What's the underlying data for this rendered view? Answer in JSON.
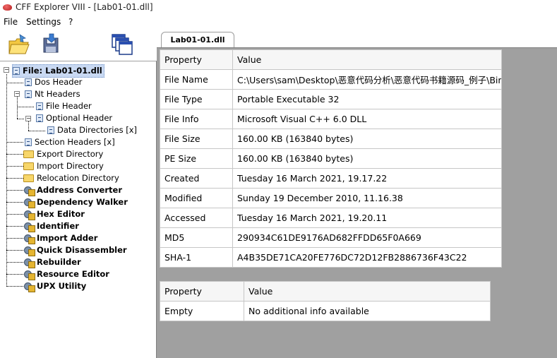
{
  "window": {
    "title": "CFF Explorer VIII - [Lab01-01.dll]"
  },
  "menu": [
    {
      "label": "File"
    },
    {
      "label": "Settings"
    },
    {
      "label": "?"
    }
  ],
  "toolbar": [
    {
      "icon": "open-folder-icon"
    },
    {
      "icon": "save-disk-icon"
    },
    {
      "icon": "windows-cascade-icon"
    }
  ],
  "tree": {
    "root": "File: Lab01-01.dll",
    "items": [
      {
        "label": "Dos Header",
        "icon": "document-icon",
        "bold": false
      },
      {
        "label": "Nt Headers",
        "icon": "document-icon",
        "bold": false
      },
      {
        "label": "File Header",
        "icon": "document-icon",
        "bold": false
      },
      {
        "label": "Optional Header",
        "icon": "document-icon",
        "bold": false
      },
      {
        "label": "Data Directories [x]",
        "icon": "document-icon",
        "bold": false
      },
      {
        "label": "Section Headers [x]",
        "icon": "document-icon",
        "bold": false
      },
      {
        "label": "Export Directory",
        "icon": "folder-icon",
        "bold": false
      },
      {
        "label": "Import Directory",
        "icon": "folder-icon",
        "bold": false
      },
      {
        "label": "Relocation Directory",
        "icon": "folder-icon",
        "bold": false
      },
      {
        "label": "Address Converter",
        "icon": "tool-icon",
        "bold": true
      },
      {
        "label": "Dependency Walker",
        "icon": "tool-icon",
        "bold": true
      },
      {
        "label": "Hex Editor",
        "icon": "tool-icon",
        "bold": true
      },
      {
        "label": "Identifier",
        "icon": "tool-icon",
        "bold": true
      },
      {
        "label": "Import Adder",
        "icon": "tool-icon",
        "bold": true
      },
      {
        "label": "Quick Disassembler",
        "icon": "tool-icon",
        "bold": true
      },
      {
        "label": "Rebuilder",
        "icon": "tool-icon",
        "bold": true
      },
      {
        "label": "Resource Editor",
        "icon": "tool-icon",
        "bold": true
      },
      {
        "label": "UPX Utility",
        "icon": "tool-icon",
        "bold": true
      }
    ]
  },
  "tab": {
    "label": "Lab01-01.dll"
  },
  "file_info": {
    "columns": [
      "Property",
      "Value"
    ],
    "rows": [
      [
        "File Name",
        "C:\\Users\\sam\\Desktop\\恶意代码分析\\恶意代码书籍源码_例子\\Bin..."
      ],
      [
        "File Type",
        "Portable Executable 32"
      ],
      [
        "File Info",
        "Microsoft Visual C++ 6.0 DLL"
      ],
      [
        "File Size",
        "160.00 KB (163840 bytes)"
      ],
      [
        "PE Size",
        "160.00 KB (163840 bytes)"
      ],
      [
        "Created",
        "Tuesday 16 March 2021, 19.17.22"
      ],
      [
        "Modified",
        "Sunday 19 December 2010, 11.16.38"
      ],
      [
        "Accessed",
        "Tuesday 16 March 2021, 19.20.11"
      ],
      [
        "MD5",
        "290934C61DE9176AD682FFDD65F0A669"
      ],
      [
        "SHA-1",
        "A4B35DE71CA20FE776DC72D12FB2886736F43C22"
      ]
    ]
  },
  "extra_info": {
    "columns": [
      "Property",
      "Value"
    ],
    "rows": [
      [
        "Empty",
        "No additional info available"
      ]
    ]
  }
}
